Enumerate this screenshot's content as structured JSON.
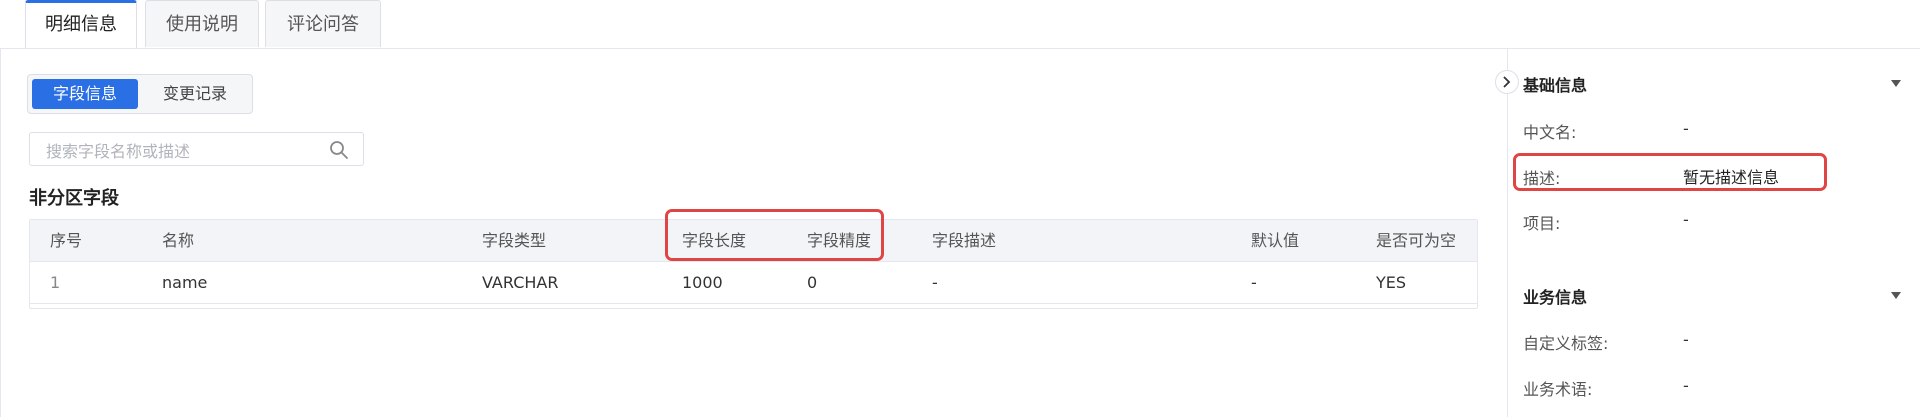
{
  "tabs": [
    {
      "label": "明细信息",
      "active": true
    },
    {
      "label": "使用说明",
      "active": false
    },
    {
      "label": "评论问答",
      "active": false
    }
  ],
  "segment": {
    "options": [
      "字段信息",
      "变更记录"
    ],
    "selected": "字段信息"
  },
  "search": {
    "placeholder": "搜索字段名称或描述",
    "value": "",
    "icon": "search-icon"
  },
  "section_title": "非分区字段",
  "table": {
    "headers": [
      "序号",
      "名称",
      "字段类型",
      "字段长度",
      "字段精度",
      "字段描述",
      "默认值",
      "是否可为空"
    ],
    "rows": [
      [
        "1",
        "name",
        "VARCHAR",
        "1000",
        "0",
        "-",
        "-",
        "YES"
      ]
    ]
  },
  "side_panel": {
    "basic": {
      "title": "基础信息",
      "fields": [
        {
          "label": "中文名:",
          "value": "-"
        },
        {
          "label": "描述:",
          "value": "暂无描述信息"
        },
        {
          "label": "项目:",
          "value": "-"
        }
      ]
    },
    "business": {
      "title": "业务信息",
      "fields": [
        {
          "label": "自定义标签:",
          "value": "-"
        },
        {
          "label": "业务术语:",
          "value": "-"
        }
      ]
    }
  },
  "colors": {
    "accent": "#2b6fe5",
    "highlight": "#e04545"
  }
}
